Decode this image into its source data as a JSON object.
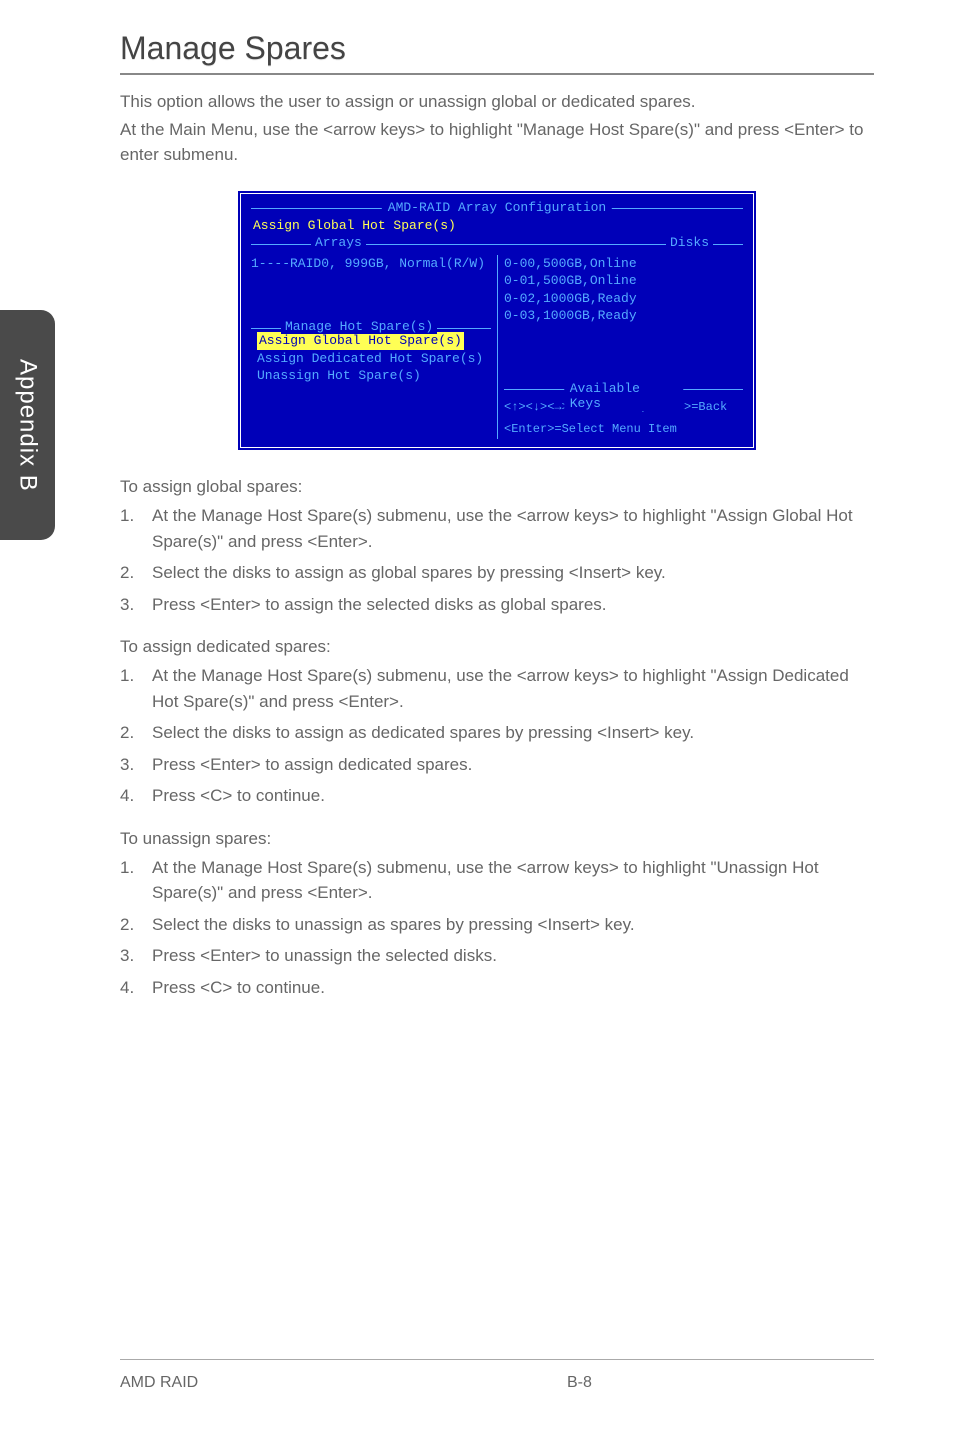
{
  "sideTab": "Appendix B",
  "heading": "Manage Spares",
  "intro1": "This option allows the user to assign or unassign global or dedicated spares.",
  "intro2": "At the Main Menu, use the <arrow keys> to highlight \"Manage Host Spare(s)\" and press <Enter> to enter submenu.",
  "bios": {
    "title": "AMD-RAID Array Configuration",
    "subtitle": "Assign Global Hot Spare(s)",
    "colArrays": "Arrays",
    "colDisks": "Disks",
    "arrayLine": "1----RAID0, 999GB, Normal(R/W)",
    "disks": {
      "d0": "0-00,500GB,Online",
      "d1": "0-01,500GB,Online",
      "d2": "0-02,1000GB,Ready",
      "d3": "0-03,1000GB,Ready"
    },
    "manageLegend": "Manage Hot Spare(s)",
    "opt1": "Assign Global Hot Spare(s)",
    "opt2": "Assign Dedicated Hot Spare(s)",
    "opt3": "Unassign Hot Spare(s)",
    "availLegend": "Available Keys",
    "keys1": "<↑><↓><→><←>=Choose, <Esc>=Back",
    "keys2": "<Enter>=Select Menu Item"
  },
  "globalHead": "To assign global spares:",
  "global": {
    "s1": "At the Manage Host Spare(s) submenu, use the <arrow keys> to highlight \"Assign Global Hot Spare(s)\" and press <Enter>.",
    "s2": "Select the disks to assign as global spares by pressing <Insert> key.",
    "s3": "Press <Enter> to assign the selected disks as global spares."
  },
  "dedicatedHead": "To assign dedicated spares:",
  "dedicated": {
    "s1": "At the Manage Host Spare(s) submenu, use the <arrow keys> to highlight \"Assign Dedicated Hot Spare(s)\" and press <Enter>.",
    "s2": "Select the disks to assign as dedicated spares by pressing <Insert> key.",
    "s3": "Press <Enter> to assign dedicated spares.",
    "s4": "Press <C> to continue."
  },
  "unassignHead": "To unassign spares:",
  "unassign": {
    "s1": "At the Manage Host Spare(s) submenu, use the <arrow keys> to highlight \"Unassign Hot Spare(s)\" and press <Enter>.",
    "s2": "Select the disks to unassign as spares by pressing <Insert> key.",
    "s3": "Press <Enter> to unassign the selected disks.",
    "s4": "Press <C> to continue."
  },
  "footer": {
    "left": "AMD RAID",
    "center": "B-8"
  }
}
